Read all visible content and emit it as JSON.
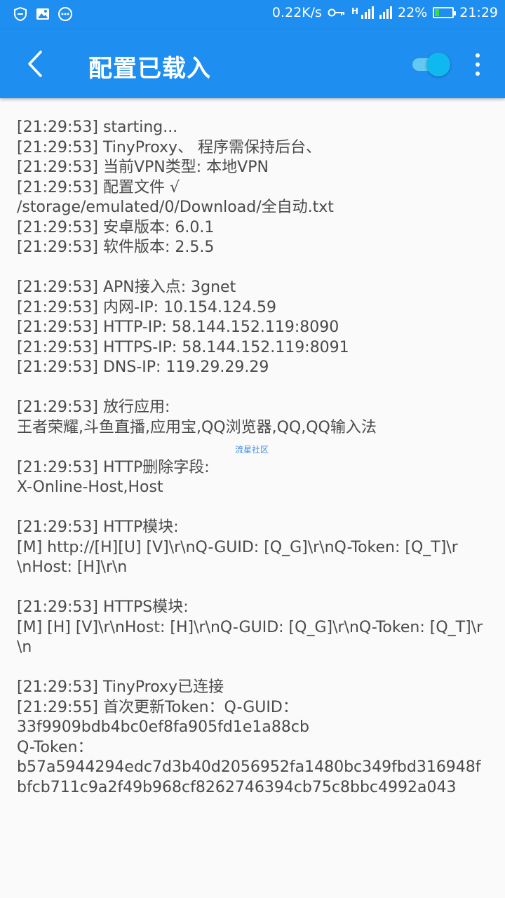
{
  "status_bar": {
    "net_speed": "0.22K/s",
    "signal_label": "H",
    "battery_percent": "22%",
    "battery_level": 0.22,
    "time": "21:29",
    "accent_color": "#1e8ff0",
    "left_icons": [
      "shield-icon",
      "image-icon",
      "message-icon"
    ]
  },
  "app_bar": {
    "title": "配置已载入",
    "vpn_toggle_on": true
  },
  "log": {
    "lines": [
      "[21:29:53] starting...",
      "[21:29:53] TinyProxy、 程序需保持后台、",
      "[21:29:53] 当前VPN类型: 本地VPN",
      "[21:29:53] 配置文件 √",
      "/storage/emulated/0/Download/全自动.txt",
      "[21:29:53] 安卓版本: 6.0.1",
      "[21:29:53] 软件版本: 2.5.5",
      "",
      "[21:29:53] APN接入点: 3gnet",
      "[21:29:53] 内网-IP: 10.154.124.59",
      "[21:29:53] HTTP-IP: 58.144.152.119:8090",
      "[21:29:53] HTTPS-IP: 58.144.152.119:8091",
      "[21:29:53] DNS-IP: 119.29.29.29",
      "",
      "[21:29:53] 放行应用:",
      "王者荣耀,斗鱼直播,应用宝,QQ浏览器,QQ,QQ输入法",
      "",
      "[21:29:53] HTTP删除字段:",
      "X-Online-Host,Host",
      "",
      "[21:29:53] HTTP模块:",
      "[M] http://[H][U] [V]\\r\\nQ-GUID: [Q_G]\\r\\nQ-Token: [Q_T]\\r",
      "\\nHost: [H]\\r\\n",
      "",
      "[21:29:53] HTTPS模块:",
      "[M] [H] [V]\\r\\nHost: [H]\\r\\nQ-GUID: [Q_G]\\r\\nQ-Token: [Q_T]\\r",
      "\\n",
      "",
      "[21:29:53] TinyProxy已连接",
      "[21:29:55] 首次更新Token：Q-GUID：",
      "33f9909bdb4bc0ef8fa905fd1e1a88cb",
      "Q-Token：",
      "b57a5944294edc7d3b40d2056952fa1480bc349fbd316948f",
      "bfcb711c9a2f49b968cf8262746394cb75c8bbc4992a043"
    ]
  },
  "watermark": "流星社区"
}
